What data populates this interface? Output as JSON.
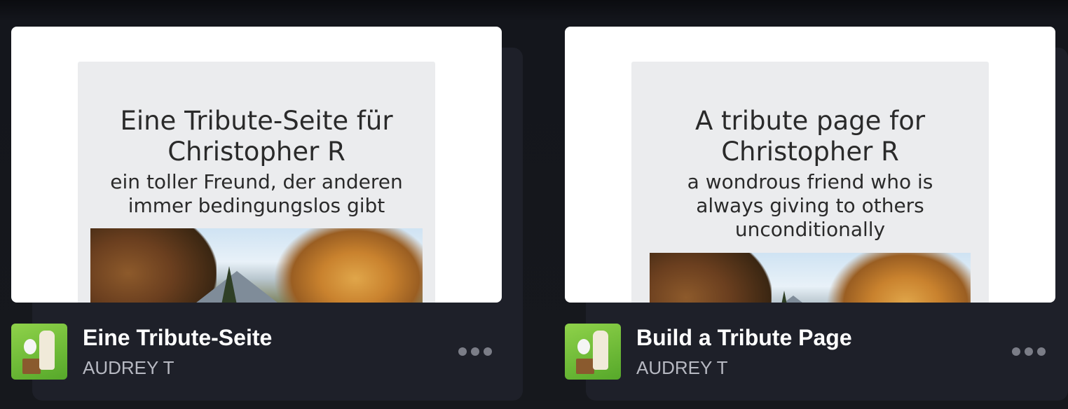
{
  "cards": [
    {
      "preview_title": "Eine Tribute-Seite für Christopher R",
      "preview_subtitle": "ein toller Freund, der anderen immer bedingungslos gibt",
      "title": "Eine Tribute-Seite",
      "author": "AUDREY T"
    },
    {
      "preview_title": "A tribute page for Christopher R",
      "preview_subtitle": "a wondrous friend who is always giving to others unconditionally",
      "title": "Build a Tribute Page",
      "author": "AUDREY T"
    }
  ],
  "icons": {
    "more": "more-options-icon",
    "avatar": "author-avatar"
  },
  "colors": {
    "card_background": "#1e2029",
    "preview_panel": "#ebecee",
    "avatar_green": "#6dbb35",
    "menu_dots": "#7b7d87"
  }
}
